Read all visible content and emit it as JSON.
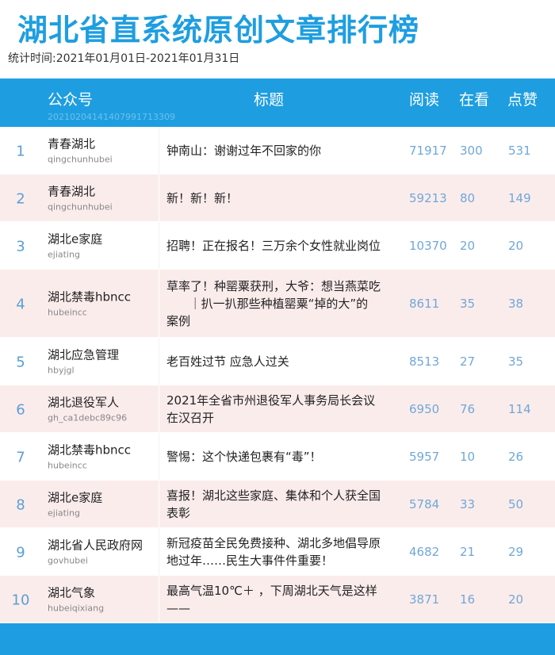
{
  "page": {
    "title": "湖北省直系统原创文章排行榜",
    "period": "统计时间:2021年01月01日-2021年01月31日"
  },
  "header": {
    "account": "公众号",
    "report_id": "20210204141407991713309",
    "title": "标题",
    "read": "阅读",
    "view": "在看",
    "like": "点赞"
  },
  "colors": {
    "accent": "#1e9ee0",
    "alt_row": "#fbecec",
    "number": "#6fa8d8"
  },
  "rows": [
    {
      "rank": "1",
      "name": "青春湖北",
      "id": "qingchunhubei",
      "title": "钟南山：谢谢过年不回家的你",
      "read": "71917",
      "view": "300",
      "like": "531"
    },
    {
      "rank": "2",
      "name": "青春湖北",
      "id": "qingchunhubei",
      "title": "新！新！新！",
      "read": "59213",
      "view": "80",
      "like": "149"
    },
    {
      "rank": "3",
      "name": "湖北e家庭",
      "id": "ejiating",
      "title": "招聘！正在报名！三万余个女性就业岗位",
      "read": "10370",
      "view": "20",
      "like": "20"
    },
    {
      "rank": "4",
      "name": "湖北禁毒hbncc",
      "id": "hubeincc",
      "title": "草率了！种罂粟获刑，大爷：想当燕菜吃\n      ｜扒一扒那些种植罂粟“掉的大”的\n案例",
      "read": "8611",
      "view": "35",
      "like": "38"
    },
    {
      "rank": "5",
      "name": "湖北应急管理",
      "id": "hbyjgl",
      "title": "老百姓过节 应急人过关",
      "read": "8513",
      "view": "27",
      "like": "35"
    },
    {
      "rank": "6",
      "name": "湖北退役军人",
      "id": "gh_ca1debc89c96",
      "title": "2021年全省市州退役军人事务局长会议\n在汉召开",
      "read": "6950",
      "view": "76",
      "like": "114"
    },
    {
      "rank": "7",
      "name": "湖北禁毒hbncc",
      "id": "hubeincc",
      "title": "警惕：这个快递包裹有“毒”！",
      "read": "5957",
      "view": "10",
      "like": "26"
    },
    {
      "rank": "8",
      "name": "湖北e家庭",
      "id": "ejiating",
      "title": "喜报！湖北这些家庭、集体和个人获全国\n表彰",
      "read": "5784",
      "view": "33",
      "like": "50"
    },
    {
      "rank": "9",
      "name": "湖北省人民政府网",
      "id": "govhubei",
      "title": "新冠疫苗全民免费接种、湖北多地倡导原\n地过年……民生大事件件重要！",
      "read": "4682",
      "view": "21",
      "like": "29"
    },
    {
      "rank": "10",
      "name": "湖北气象",
      "id": "hubeiqixiang",
      "title": "最高气温10℃＋ ，下周湖北天气是这样\n——",
      "read": "3871",
      "view": "16",
      "like": "20"
    }
  ]
}
